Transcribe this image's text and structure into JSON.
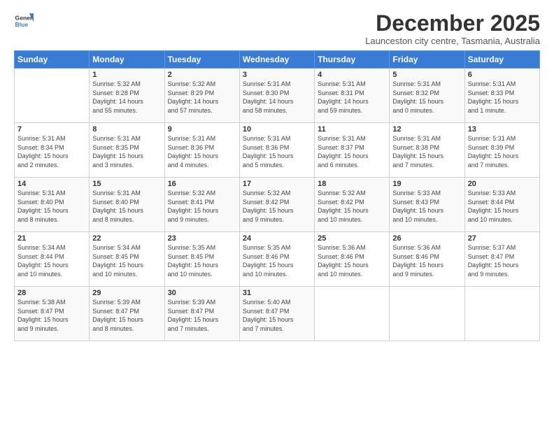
{
  "header": {
    "logo_general": "General",
    "logo_blue": "Blue",
    "title": "December 2025",
    "subtitle": "Launceston city centre, Tasmania, Australia"
  },
  "weekdays": [
    "Sunday",
    "Monday",
    "Tuesday",
    "Wednesday",
    "Thursday",
    "Friday",
    "Saturday"
  ],
  "weeks": [
    [
      {
        "day": "",
        "info": ""
      },
      {
        "day": "1",
        "info": "Sunrise: 5:32 AM\nSunset: 8:28 PM\nDaylight: 14 hours\nand 55 minutes."
      },
      {
        "day": "2",
        "info": "Sunrise: 5:32 AM\nSunset: 8:29 PM\nDaylight: 14 hours\nand 57 minutes."
      },
      {
        "day": "3",
        "info": "Sunrise: 5:31 AM\nSunset: 8:30 PM\nDaylight: 14 hours\nand 58 minutes."
      },
      {
        "day": "4",
        "info": "Sunrise: 5:31 AM\nSunset: 8:31 PM\nDaylight: 14 hours\nand 59 minutes."
      },
      {
        "day": "5",
        "info": "Sunrise: 5:31 AM\nSunset: 8:32 PM\nDaylight: 15 hours\nand 0 minutes."
      },
      {
        "day": "6",
        "info": "Sunrise: 5:31 AM\nSunset: 8:33 PM\nDaylight: 15 hours\nand 1 minute."
      }
    ],
    [
      {
        "day": "7",
        "info": "Sunrise: 5:31 AM\nSunset: 8:34 PM\nDaylight: 15 hours\nand 2 minutes."
      },
      {
        "day": "8",
        "info": "Sunrise: 5:31 AM\nSunset: 8:35 PM\nDaylight: 15 hours\nand 3 minutes."
      },
      {
        "day": "9",
        "info": "Sunrise: 5:31 AM\nSunset: 8:36 PM\nDaylight: 15 hours\nand 4 minutes."
      },
      {
        "day": "10",
        "info": "Sunrise: 5:31 AM\nSunset: 8:36 PM\nDaylight: 15 hours\nand 5 minutes."
      },
      {
        "day": "11",
        "info": "Sunrise: 5:31 AM\nSunset: 8:37 PM\nDaylight: 15 hours\nand 6 minutes."
      },
      {
        "day": "12",
        "info": "Sunrise: 5:31 AM\nSunset: 8:38 PM\nDaylight: 15 hours\nand 7 minutes."
      },
      {
        "day": "13",
        "info": "Sunrise: 5:31 AM\nSunset: 8:39 PM\nDaylight: 15 hours\nand 7 minutes."
      }
    ],
    [
      {
        "day": "14",
        "info": "Sunrise: 5:31 AM\nSunset: 8:40 PM\nDaylight: 15 hours\nand 8 minutes."
      },
      {
        "day": "15",
        "info": "Sunrise: 5:31 AM\nSunset: 8:40 PM\nDaylight: 15 hours\nand 8 minutes."
      },
      {
        "day": "16",
        "info": "Sunrise: 5:32 AM\nSunset: 8:41 PM\nDaylight: 15 hours\nand 9 minutes."
      },
      {
        "day": "17",
        "info": "Sunrise: 5:32 AM\nSunset: 8:42 PM\nDaylight: 15 hours\nand 9 minutes."
      },
      {
        "day": "18",
        "info": "Sunrise: 5:32 AM\nSunset: 8:42 PM\nDaylight: 15 hours\nand 10 minutes."
      },
      {
        "day": "19",
        "info": "Sunrise: 5:33 AM\nSunset: 8:43 PM\nDaylight: 15 hours\nand 10 minutes."
      },
      {
        "day": "20",
        "info": "Sunrise: 5:33 AM\nSunset: 8:44 PM\nDaylight: 15 hours\nand 10 minutes."
      }
    ],
    [
      {
        "day": "21",
        "info": "Sunrise: 5:34 AM\nSunset: 8:44 PM\nDaylight: 15 hours\nand 10 minutes."
      },
      {
        "day": "22",
        "info": "Sunrise: 5:34 AM\nSunset: 8:45 PM\nDaylight: 15 hours\nand 10 minutes."
      },
      {
        "day": "23",
        "info": "Sunrise: 5:35 AM\nSunset: 8:45 PM\nDaylight: 15 hours\nand 10 minutes."
      },
      {
        "day": "24",
        "info": "Sunrise: 5:35 AM\nSunset: 8:46 PM\nDaylight: 15 hours\nand 10 minutes."
      },
      {
        "day": "25",
        "info": "Sunrise: 5:36 AM\nSunset: 8:46 PM\nDaylight: 15 hours\nand 10 minutes."
      },
      {
        "day": "26",
        "info": "Sunrise: 5:36 AM\nSunset: 8:46 PM\nDaylight: 15 hours\nand 9 minutes."
      },
      {
        "day": "27",
        "info": "Sunrise: 5:37 AM\nSunset: 8:47 PM\nDaylight: 15 hours\nand 9 minutes."
      }
    ],
    [
      {
        "day": "28",
        "info": "Sunrise: 5:38 AM\nSunset: 8:47 PM\nDaylight: 15 hours\nand 9 minutes."
      },
      {
        "day": "29",
        "info": "Sunrise: 5:39 AM\nSunset: 8:47 PM\nDaylight: 15 hours\nand 8 minutes."
      },
      {
        "day": "30",
        "info": "Sunrise: 5:39 AM\nSunset: 8:47 PM\nDaylight: 15 hours\nand 7 minutes."
      },
      {
        "day": "31",
        "info": "Sunrise: 5:40 AM\nSunset: 8:47 PM\nDaylight: 15 hours\nand 7 minutes."
      },
      {
        "day": "",
        "info": ""
      },
      {
        "day": "",
        "info": ""
      },
      {
        "day": "",
        "info": ""
      }
    ]
  ]
}
